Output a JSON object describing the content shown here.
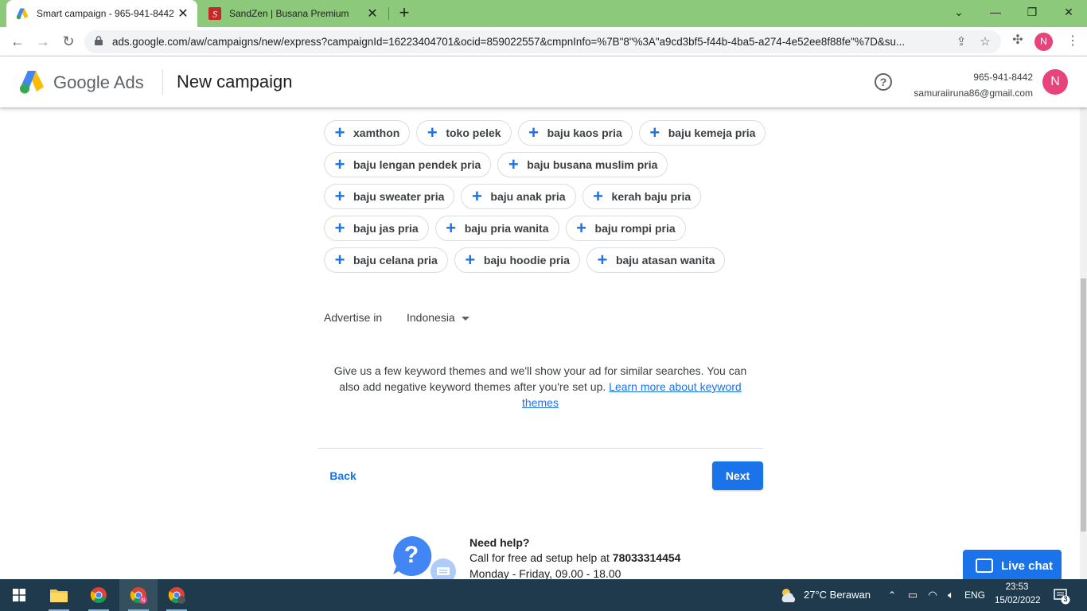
{
  "browser": {
    "tabs": [
      {
        "title": "Smart campaign - 965-941-8442",
        "active": true
      },
      {
        "title": "SandZen | Busana Premium",
        "active": false
      }
    ],
    "url": "ads.google.com/aw/campaigns/new/express?campaignId=16223404701&ocid=859022557&cmpnInfo=%7B\"8\"%3A\"a9cd3bf5-f44b-4ba5-a274-4e52ee8f88fe\"%7D&su...",
    "profile_initial": "N"
  },
  "header": {
    "brand": "Google Ads",
    "page_title": "New campaign",
    "account_id": "965-941-8442",
    "account_email": "samuraiiruna86@gmail.com",
    "avatar_initial": "N"
  },
  "keywords": {
    "rows": [
      [
        "xamthon",
        "toko pelek",
        "baju kaos pria",
        "baju kemeja pria"
      ],
      [
        "baju lengan pendek pria",
        "baju busana muslim pria"
      ],
      [
        "baju sweater pria",
        "baju anak pria",
        "kerah baju pria"
      ],
      [
        "baju jas pria",
        "baju pria wanita",
        "baju rompi pria"
      ],
      [
        "baju celana pria",
        "baju hoodie pria",
        "baju atasan wanita"
      ]
    ]
  },
  "advertise": {
    "label": "Advertise in",
    "value": "Indonesia"
  },
  "info": {
    "text": "Give us a few keyword themes and we'll show your ad for similar searches. You can also add negative keyword themes after you're set up.",
    "link": "Learn more about keyword themes"
  },
  "actions": {
    "back": "Back",
    "next": "Next"
  },
  "help": {
    "title": "Need help?",
    "call_prefix": "Call for free ad setup help at",
    "phone": "78033314454",
    "hours": "Monday - Friday, 09.00 - 18.00"
  },
  "livechat": {
    "label": "Live chat"
  },
  "taskbar": {
    "weather": "27°C  Berawan",
    "lang": "ENG",
    "time": "23:53",
    "date": "15/02/2022",
    "notifications": "3"
  },
  "colors": {
    "accent": "#1a73e8",
    "tabstrip": "#8dc97a",
    "taskbar": "#1f3a4d",
    "avatar": "#e8437a"
  }
}
